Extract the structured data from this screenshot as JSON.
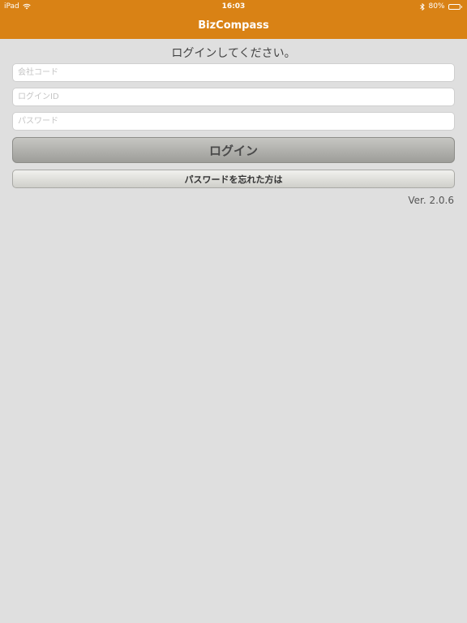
{
  "status_bar": {
    "carrier": "iPad",
    "time": "16:03",
    "battery": "80%",
    "battery_level": 0.8
  },
  "header": {
    "title": "BizCompass",
    "color": "#d98215"
  },
  "login": {
    "prompt": "ログインしてください。",
    "company_code_placeholder": "会社コード",
    "login_id_placeholder": "ログインID",
    "password_placeholder": "パスワード",
    "login_button": "ログイン",
    "forgot_password_button": "パスワードを忘れた方は"
  },
  "version": "Ver. 2.0.6"
}
